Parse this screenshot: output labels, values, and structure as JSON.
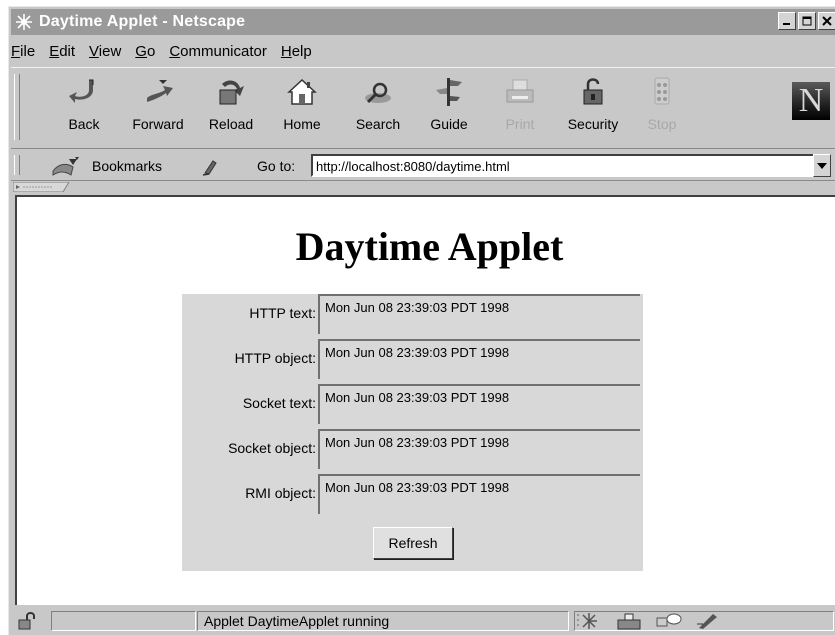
{
  "window": {
    "title": "Daytime Applet - Netscape",
    "controls": [
      "minimize",
      "maximize",
      "close"
    ]
  },
  "menubar": {
    "items": [
      {
        "label": "File",
        "key": "F",
        "rest": "ile"
      },
      {
        "label": "Edit",
        "key": "E",
        "rest": "dit"
      },
      {
        "label": "View",
        "key": "V",
        "rest": "iew"
      },
      {
        "label": "Go",
        "key": "G",
        "rest": "o"
      },
      {
        "label": "Communicator",
        "key": "C",
        "rest": "ommunicator"
      },
      {
        "label": "Help",
        "key": "H",
        "rest": "elp"
      }
    ]
  },
  "toolbar": {
    "buttons": [
      {
        "label": "Back",
        "icon": "back-icon",
        "enabled": true
      },
      {
        "label": "Forward",
        "icon": "forward-icon",
        "enabled": true
      },
      {
        "label": "Reload",
        "icon": "reload-icon",
        "enabled": true
      },
      {
        "label": "Home",
        "icon": "home-icon",
        "enabled": true
      },
      {
        "label": "Search",
        "icon": "search-icon",
        "enabled": true
      },
      {
        "label": "Guide",
        "icon": "guide-icon",
        "enabled": true
      },
      {
        "label": "Print",
        "icon": "print-icon",
        "enabled": false
      },
      {
        "label": "Security",
        "icon": "security-lock-icon",
        "enabled": true
      },
      {
        "label": "Stop",
        "icon": "stop-icon",
        "enabled": false
      }
    ],
    "logo": "N"
  },
  "location": {
    "bookmarks_label": "Bookmarks",
    "goto_label": "Go to:",
    "url": "http://localhost:8080/daytime.html"
  },
  "page": {
    "title": "Daytime Applet",
    "rows": [
      {
        "label": "HTTP text:",
        "value": "Mon Jun 08 23:39:03 PDT 1998"
      },
      {
        "label": "HTTP object:",
        "value": "Mon Jun 08 23:39:03 PDT 1998"
      },
      {
        "label": "Socket text:",
        "value": "Mon Jun 08 23:39:03 PDT 1998"
      },
      {
        "label": "Socket object:",
        "value": "Mon Jun 08 23:39:03 PDT 1998"
      },
      {
        "label": "RMI object:",
        "value": "Mon Jun 08 23:39:03 PDT 1998"
      }
    ],
    "refresh_label": "Refresh"
  },
  "status": {
    "text": "Applet DaytimeApplet running"
  },
  "colors": {
    "chrome": "#c8c8c8",
    "titlebar": "#9a9a9a",
    "applet_bg": "#d8d8d8",
    "disabled_text": "#a8a8a8"
  }
}
